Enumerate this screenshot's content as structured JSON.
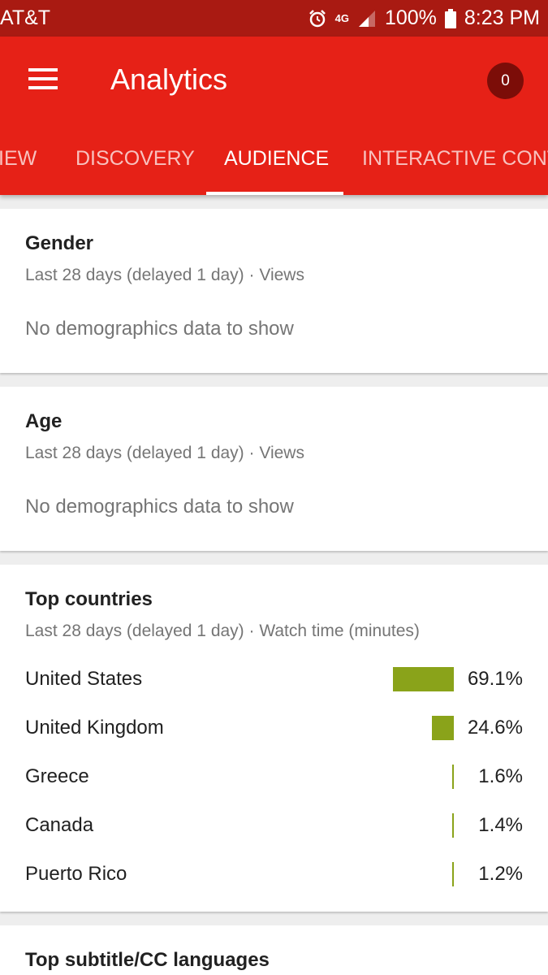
{
  "status_bar": {
    "carrier": "AT&T",
    "network": "4G LTE",
    "battery": "100%",
    "time": "8:23 PM"
  },
  "app_bar": {
    "title": "Analytics",
    "notification_count": "0",
    "colors": {
      "primary": "#e62117",
      "status": "#a91a12",
      "badge": "#7c0d08"
    }
  },
  "tabs": [
    {
      "label": "IEW",
      "active": false
    },
    {
      "label": "DISCOVERY",
      "active": false
    },
    {
      "label": "AUDIENCE",
      "active": true
    },
    {
      "label": "INTERACTIVE CONT",
      "active": false
    }
  ],
  "gender_card": {
    "title": "Gender",
    "subtitle": "Last 28 days (delayed 1 day) · Views",
    "empty_message": "No demographics data to show"
  },
  "age_card": {
    "title": "Age",
    "subtitle": "Last 28 days (delayed 1 day) · Views",
    "empty_message": "No demographics data to show"
  },
  "countries_card": {
    "title": "Top countries",
    "subtitle": "Last 28 days (delayed 1 day) · Watch time (minutes)",
    "bar_color": "#8aa31a",
    "rows": [
      {
        "name": "United States",
        "percent_label": "69.1%",
        "value": 69.1
      },
      {
        "name": "United Kingdom",
        "percent_label": "24.6%",
        "value": 24.6
      },
      {
        "name": "Greece",
        "percent_label": "1.6%",
        "value": 1.6
      },
      {
        "name": "Canada",
        "percent_label": "1.4%",
        "value": 1.4
      },
      {
        "name": "Puerto Rico",
        "percent_label": "1.2%",
        "value": 1.2
      }
    ]
  },
  "subtitles_card": {
    "title": "Top subtitle/CC languages"
  }
}
